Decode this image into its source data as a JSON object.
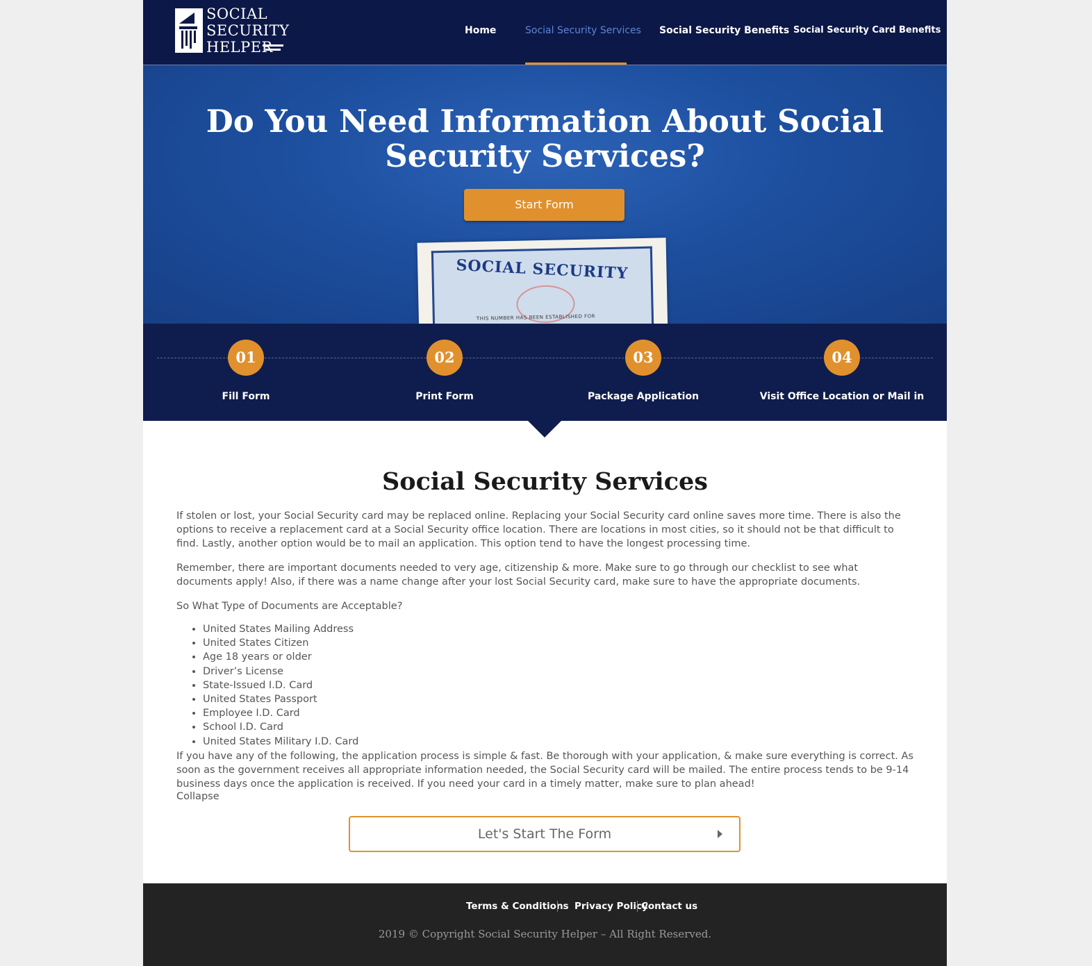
{
  "header": {
    "logo_lines": [
      "SOCIAL",
      "SECURITY",
      "HELPER"
    ],
    "nav": [
      {
        "label": "Home"
      },
      {
        "label": "Social Security Services",
        "active": true
      },
      {
        "label": "Social Security Benefits"
      },
      {
        "label": "Social Security Card Benefits"
      }
    ]
  },
  "hero": {
    "title": "Do You Need Information About Social Security Services?",
    "button_label": "Start Form",
    "card_title": "SOCIAL SECURITY",
    "card_small_text": "THIS NUMBER HAS BEEN ESTABLISHED FOR"
  },
  "steps": [
    {
      "number": "01",
      "label": "Fill Form"
    },
    {
      "number": "02",
      "label": "Print Form"
    },
    {
      "number": "03",
      "label": "Package Application"
    },
    {
      "number": "04",
      "label": "Visit Office Location or Mail in"
    }
  ],
  "content": {
    "title": "Social Security Services",
    "paragraph1": "If stolen or lost, your Social Security card may be replaced online. Replacing your Social Security card online saves more time. There is also the options to receive a replacement card at a Social Security office location. There are locations in most cities, so it should not be that difficult to find. Lastly, another option would be to mail an application. This option tend to have the longest processing time.",
    "paragraph2": "Remember, there are important documents needed to very age, citizenship & more. Make sure to go through our checklist to see what documents apply! Also, if there was a name change after your lost Social Security card, make sure to have the appropriate documents.",
    "question": "So What Type of Documents are Acceptable?",
    "documents": [
      "United States Mailing Address",
      "United States Citizen",
      "Age 18 years or older",
      "Driver’s License",
      "State-Issued I.D. Card",
      "United States Passport",
      "Employee I.D. Card",
      "School I.D. Card",
      "United States Military I.D. Card"
    ],
    "paragraph3": "If you have any of the following, the application process is simple & fast. Be thorough with your application, & make sure everything is correct. As soon as the government receives all appropriate information needed, the Social Security card will be mailed. The entire process tends to be 9-14 business days once the application is received. If you need your card in a timely matter, make sure to plan ahead!",
    "collapse_label": "Collapse",
    "form_button_label": "Let's Start The Form"
  },
  "footer": {
    "links": [
      "Terms & Conditions",
      "Privacy Policy",
      "Contact us"
    ],
    "copyright": "2019 © Copyright Social Security Helper – All Right Reserved."
  },
  "colors": {
    "header_bg": "#0c1847",
    "accent": "#e0912d",
    "active_nav": "#5b86d8",
    "footer_bg": "#232323"
  }
}
